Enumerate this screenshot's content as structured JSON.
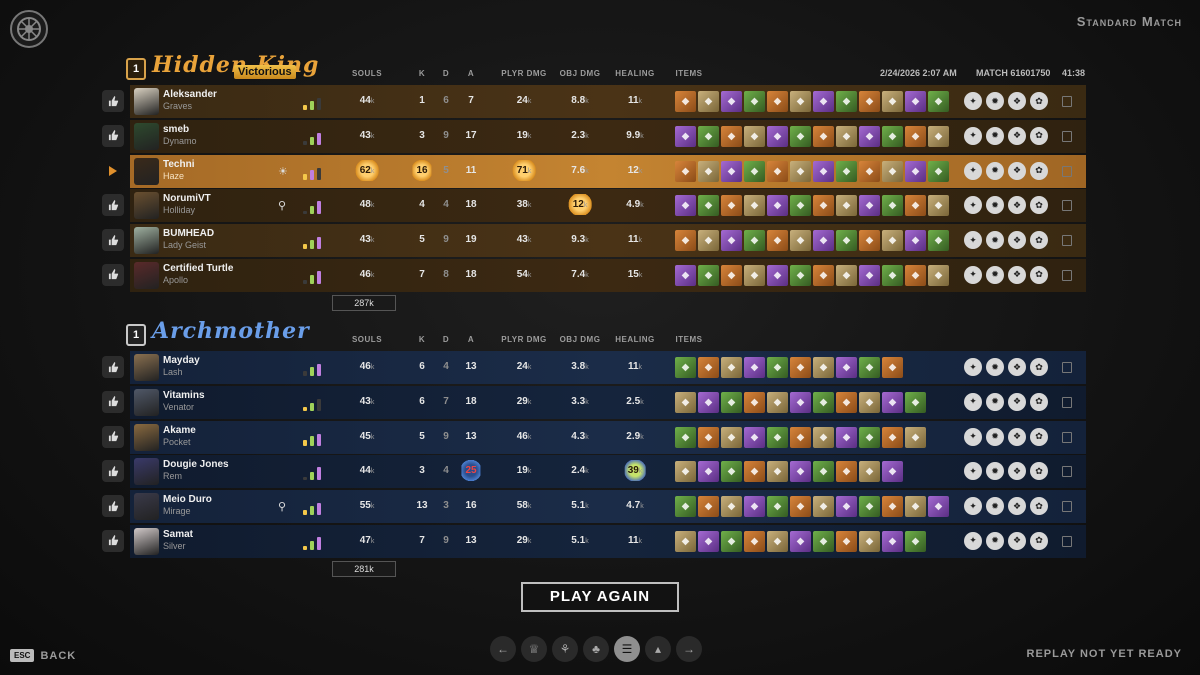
{
  "header": {
    "match_type": "Standard Match"
  },
  "columns": {
    "souls": "SOULS",
    "k": "K",
    "d": "D",
    "a": "A",
    "plyr_dmg": "PLYR DMG",
    "obj_dmg": "OBJ DMG",
    "healing": "HEALING",
    "items": "ITEMS"
  },
  "match_meta": {
    "date": "2/24/2026 2:07 AM",
    "match_id": "MATCH 61601750",
    "duration": "41:38"
  },
  "team_amber": {
    "name": "Hidden King",
    "badge": "1",
    "result": "Victorious",
    "total_souls": "287k",
    "players": [
      {
        "name": "Aleksander",
        "hero": "Graves",
        "souls": "44",
        "k": "1",
        "d": "6",
        "a": "7",
        "plyr": "24",
        "obj": "8.8",
        "heal": "11"
      },
      {
        "name": "smeb",
        "hero": "Dynamo",
        "souls": "43",
        "k": "3",
        "d": "9",
        "a": "17",
        "plyr": "19",
        "obj": "2.3",
        "heal": "9.9"
      },
      {
        "name": "Techni",
        "hero": "Haze",
        "souls": "62",
        "k": "16",
        "d": "5",
        "a": "11",
        "plyr": "71",
        "obj": "7.6",
        "heal": "12"
      },
      {
        "name": "NorumiVT",
        "hero": "Holliday",
        "souls": "48",
        "k": "4",
        "d": "4",
        "a": "18",
        "plyr": "38",
        "obj": "12",
        "heal": "4.9"
      },
      {
        "name": "BUMHEAD",
        "hero": "Lady Geist",
        "souls": "43",
        "k": "5",
        "d": "9",
        "a": "19",
        "plyr": "43",
        "obj": "9.3",
        "heal": "11"
      },
      {
        "name": "Certified Turtle",
        "hero": "Apollo",
        "souls": "46",
        "k": "7",
        "d": "8",
        "a": "18",
        "plyr": "54",
        "obj": "7.4",
        "heal": "15"
      }
    ]
  },
  "team_blue": {
    "name": "Archmother",
    "badge": "1",
    "total_souls": "281k",
    "players": [
      {
        "name": "Mayday",
        "hero": "Lash",
        "souls": "46",
        "k": "6",
        "d": "4",
        "a": "13",
        "plyr": "24",
        "obj": "3.8",
        "heal": "11"
      },
      {
        "name": "Vitamins",
        "hero": "Venator",
        "souls": "43",
        "k": "6",
        "d": "7",
        "a": "18",
        "plyr": "29",
        "obj": "3.3",
        "heal": "2.5"
      },
      {
        "name": "Akame",
        "hero": "Pocket",
        "souls": "45",
        "k": "5",
        "d": "9",
        "a": "13",
        "plyr": "46",
        "obj": "4.3",
        "heal": "2.9"
      },
      {
        "name": "Dougie Jones",
        "hero": "Rem",
        "souls": "44",
        "k": "3",
        "d": "4",
        "a": "25",
        "plyr": "19",
        "obj": "2.4",
        "heal": "39"
      },
      {
        "name": "Meio Duro",
        "hero": "Mirage",
        "souls": "55",
        "k": "13",
        "d": "3",
        "a": "16",
        "plyr": "58",
        "obj": "5.1",
        "heal": "4.7"
      },
      {
        "name": "Samat",
        "hero": "Silver",
        "souls": "47",
        "k": "7",
        "d": "9",
        "a": "13",
        "plyr": "29",
        "obj": "5.1",
        "heal": "11"
      }
    ]
  },
  "unit_k": "k",
  "play_again": "PLAY AGAIN",
  "footer": {
    "esc": "ESC",
    "back": "BACK",
    "replay_status": "REPLAY NOT YET READY"
  },
  "colors": {
    "amber_accent": "#e9a33a",
    "blue_accent": "#6a9ee9",
    "self_row": "#c48431"
  }
}
